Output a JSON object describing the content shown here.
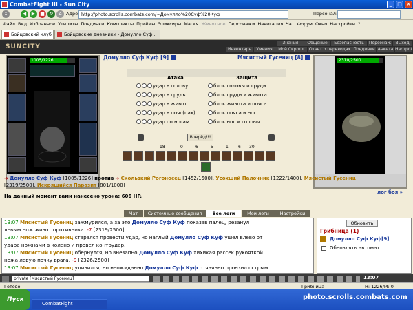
{
  "window": {
    "title": "CombatFight III - Sun City"
  },
  "toolbar": {
    "address_label": "Адрес:",
    "address": "http://photo.scrolls.combats.com/~Домулло%20Суф%20Куф",
    "personal_label": "Персонал:"
  },
  "menu": [
    "Файл",
    "Вид",
    "Избранное",
    "Утилиты",
    "Поединки",
    "Комплекты",
    "Приёмы",
    "Эликсиры",
    "Магия",
    "Животное",
    "Персонажи",
    "Навигация",
    "Чат",
    "Форум",
    "Окно",
    "Настройки",
    "?"
  ],
  "browser_tabs": [
    "Бойцовский клуб",
    "Бойцовские дневники - Домулло Суф..."
  ],
  "header": {
    "logo": "SUNCITY",
    "nav_top": [
      "Знания",
      "Общение",
      "Безопасность",
      "Персонаж",
      "Выход"
    ],
    "nav_bottom": [
      "Инвентарь",
      "Умения",
      "Мой Скролл",
      "Отчет о переводах",
      "Поединки",
      "Анкета",
      "Настройки"
    ]
  },
  "player": {
    "name": "Домулло Суф Куф [9]",
    "hp": "1005/1226",
    "hp_fraction": 0.82
  },
  "enemy": {
    "name": "Мясистый Гусениц [8]",
    "hp": "2310/2500",
    "hp_fraction": 0.92
  },
  "attack": {
    "title": "Атака",
    "rows": [
      "удар в голову",
      "удар в грудь",
      "удар в живот",
      "удар в пояс(пах)",
      "удар по ногам"
    ]
  },
  "defense": {
    "title": "Защита",
    "rows": [
      "блок головы и груди",
      "блок груди и живота",
      "блок живота и пояса",
      "блок пояса и ног",
      "блок ног и головы"
    ]
  },
  "strike_button": "Вперёд!!!",
  "stats": [
    "18",
    "0",
    "6",
    "5",
    "1",
    "6",
    "30"
  ],
  "team_line": {
    "p1": "Домулло Суф Куф",
    "p1_hp": "[1005/1226]",
    "vs": "против",
    "e1": "Скользкий Рогоносец",
    "e1_hp": "[1452/1500],",
    "e2": "Усохший Палочник",
    "e2_hp": "[1222/1400],",
    "e3": "Мясистый Гусениц",
    "e3_hp": "[2319/2500],",
    "e4": "Искрящийся Паразит",
    "e4_hp": "[801/1000]"
  },
  "damage_line": {
    "text": "На данный момент вами нанесено урона:",
    "value": "606 HP."
  },
  "fight_log_link": "лог боя »",
  "chat_tabs": [
    "Чат",
    "Системные сообщения",
    "Все логи",
    "Мои логи",
    "Настройки"
  ],
  "chat": [
    {
      "time": "13:07",
      "name": "Мясистый Гусениц",
      "text": "зажмурился, а за это",
      "target": "Домулло Суф Куф",
      "rest": "показав палец, резанул"
    },
    {
      "text": "левым нож живот противника.",
      "dmg": "-7",
      "hp": "[2319/2500]"
    },
    {
      "time": "13:07",
      "name": "Мясистый Гусениц",
      "text": "старался провести удар, но наглый",
      "target": "Домулло Суф Куф",
      "rest": "ушел влево от"
    },
    {
      "text": "удара ножнами в колено и провел контрудар."
    },
    {
      "time": "13:07",
      "name": "Мясистый Гусениц",
      "text": "обернулся, но внезапно",
      "target": "Домулло Суф Куф",
      "rest": "хихикая рассек рукояткой"
    },
    {
      "text": "ножа левую почку врага.",
      "dmg": "-9",
      "hp": "[2326/2500]"
    },
    {
      "time": "13:07",
      "name": "Мясистый Гусениц",
      "text": "удивился, но неожиданно",
      "target": "Домулло Суф Куф",
      "rest": "отчаянно пронзил острым"
    }
  ],
  "side": {
    "refresh": "Обновить",
    "group": "Грибница (1)",
    "member": "Домулло Суф Куф[9]",
    "auto": "Обновлять автомат."
  },
  "chat_input": "private [Мясистый Гусениц]",
  "clock": "13:07",
  "statusbar": {
    "left": "Готово",
    "mid": "Грибница",
    "right": "Н: 1226/М: 0"
  },
  "taskbar": {
    "start": "Пуск",
    "item": "CombatFight",
    "watermark": "photo.scrolls.combats.com"
  }
}
